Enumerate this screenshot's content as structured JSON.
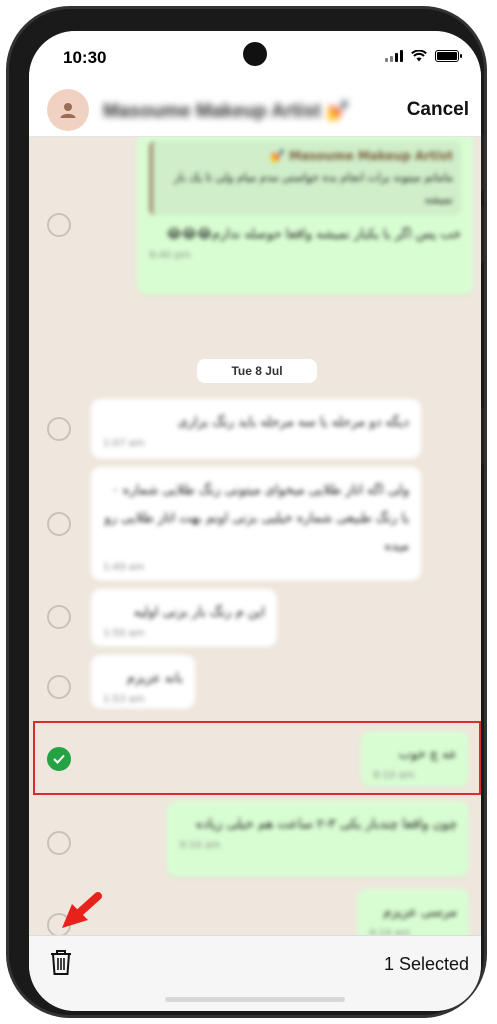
{
  "status_bar": {
    "time": "10:30"
  },
  "header": {
    "contact_name": "Masoume Makeup Artist 💅",
    "cancel_label": "Cancel"
  },
  "messages": [
    {
      "direction": "out",
      "quote_author": "Masoume Makeup Artist 💅",
      "quote_text": "ماماتم میتونه برات انجام بده خواستی مدم میام ولی تا یک بار نمیشه",
      "text": "خب پس اگر یا یکبار نمیشه واقعا حوصله ندارم😂😂😂",
      "time": "9:40 pm",
      "selected": false
    },
    {
      "direction": "in",
      "text": "دیگه دو مرحله یا سه مرحله باید رنگ بزاری",
      "time": "1:07 am",
      "selected": false
    },
    {
      "direction": "in",
      "text": "ولی اگه اتاز طلایی میخوای میتونی رنگ طلایی شماره ۰ یا رنگ طبیعی شماره خیلیی بزنی اونم بهت اتاز طلایی رو میده",
      "time": "1:49 am",
      "selected": false
    },
    {
      "direction": "in",
      "text": "این م رنگ بار بزنی اولیه",
      "time": "1:50 am",
      "selected": false
    },
    {
      "direction": "in",
      "text": "بانه عزیزم",
      "time": "1:53 am",
      "selected": false
    },
    {
      "direction": "out",
      "text": "عه چ خوب",
      "time": "9:10 am",
      "selected": true
    },
    {
      "direction": "out",
      "text": "چون واقعا چندبار یکی ۳-۲ ساعت هم خیلی زیاده",
      "time": "9:10 am",
      "selected": false
    },
    {
      "direction": "out",
      "text": "مرسی عزیزم",
      "time": "9:10 am",
      "selected": false
    }
  ],
  "date_separator": "Tue 8 Jul",
  "bottom_bar": {
    "selected_count": "1 Selected"
  },
  "colors": {
    "accent": "#25a244",
    "highlight": "#d32f2f",
    "outgoing": "#d9fdd3",
    "incoming": "#ffffff"
  }
}
